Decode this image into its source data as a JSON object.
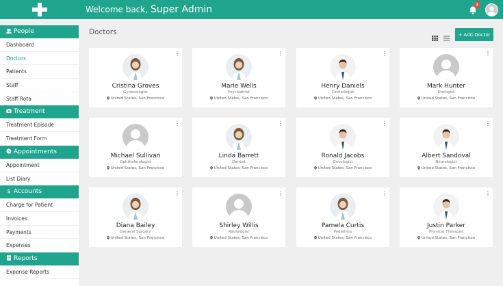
{
  "header": {
    "welcome": "Welcome back,",
    "user_name": "Super Admin",
    "notification_count": "3"
  },
  "sidebar": {
    "sections": [
      {
        "title": "People",
        "icon": "people-icon",
        "items": [
          "Dashboard",
          "Doctors",
          "Patients",
          "Staff",
          "Staff Rota"
        ]
      },
      {
        "title": "Treatment",
        "icon": "camera-icon",
        "items": [
          "Treatment Episode",
          "Treatment Form"
        ]
      },
      {
        "title": "Appointments",
        "icon": "clock-icon",
        "items": [
          "Appointment",
          "List Diary"
        ]
      },
      {
        "title": "Accounts",
        "icon": "dollar-icon",
        "items": [
          "Charge for Patient",
          "Invoices",
          "Payments",
          "Expenses"
        ]
      },
      {
        "title": "Reports",
        "icon": "document-icon",
        "items": [
          "Expense Reports"
        ]
      }
    ],
    "active_item": "Doctors"
  },
  "main": {
    "title": "Doctors",
    "add_label": "+ Add Doctor"
  },
  "doctors": [
    {
      "name": "Cristina Groves",
      "specialty": "Gynecologist",
      "location": "United States, San Francisco",
      "photo": "female-doctor"
    },
    {
      "name": "Marie Wells",
      "specialty": "Psychiatrist",
      "location": "United States, San Francisco",
      "photo": "female-doctor"
    },
    {
      "name": "Henry Daniels",
      "specialty": "Cardiologist",
      "location": "United States, San Francisco",
      "photo": "male-doctor"
    },
    {
      "name": "Mark Hunter",
      "specialty": "Urologist",
      "location": "United States, San Francisco",
      "photo": "placeholder"
    },
    {
      "name": "Michael Sullivan",
      "specialty": "Ophthalmologist",
      "location": "United States, San Francisco",
      "photo": "placeholder"
    },
    {
      "name": "Linda Barrett",
      "specialty": "Dentist",
      "location": "United States, San Francisco",
      "photo": "female-doctor"
    },
    {
      "name": "Ronald Jacobs",
      "specialty": "Oncologist",
      "location": "United States, San Francisco",
      "photo": "male-doctor"
    },
    {
      "name": "Albert Sandoval",
      "specialty": "Neurologist",
      "location": "United States, San Francisco",
      "photo": "male-doctor"
    },
    {
      "name": "Diana Bailey",
      "specialty": "General Surgery",
      "location": "United States, San Francisco",
      "photo": "female-doctor"
    },
    {
      "name": "Shirley Willis",
      "specialty": "Radiologist",
      "location": "United States, San Francisco",
      "photo": "placeholder"
    },
    {
      "name": "Pamela Curtis",
      "specialty": "Pediatrics",
      "location": "United States, San Francisco",
      "photo": "female-doctor"
    },
    {
      "name": "Justin Parker",
      "specialty": "Physical Therapist",
      "location": "United States, San Francisco",
      "photo": "male-doctor"
    }
  ],
  "colors": {
    "accent": "#1fa58e",
    "badge": "#e74c3c",
    "background": "#efefef"
  }
}
